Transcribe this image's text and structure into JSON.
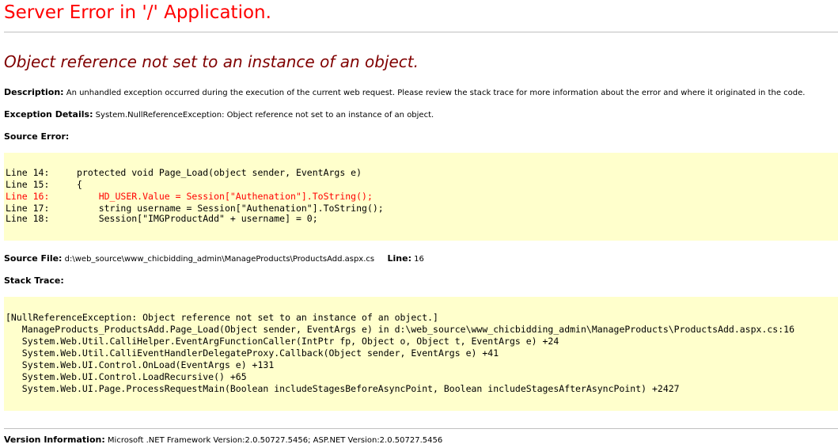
{
  "page": {
    "title": "Server Error in '/' Application.",
    "error_message": "Object reference not set to an instance of an object."
  },
  "description": {
    "label": "Description:",
    "text": "An unhandled exception occurred during the execution of the current web request. Please review the stack trace for more information about the error and where it originated in the code."
  },
  "exception_details": {
    "label": "Exception Details:",
    "text": "System.NullReferenceException: Object reference not set to an instance of an object."
  },
  "source_error": {
    "label": "Source Error:",
    "lines": [
      {
        "text": "Line 14:     protected void Page_Load(object sender, EventArgs e)",
        "is_error": false
      },
      {
        "text": "Line 15:     {",
        "is_error": false
      },
      {
        "text": "Line 16:         HD_USER.Value = Session[\"Authenation\"].ToString();",
        "is_error": true
      },
      {
        "text": "Line 17:         string username = Session[\"Authenation\"].ToString();",
        "is_error": false
      },
      {
        "text": "Line 18:         Session[\"IMGProductAdd\" + username] = 0;",
        "is_error": false
      }
    ]
  },
  "source_file": {
    "label": "Source File:",
    "path": "d:\\web_source\\www_chicbidding_admin\\ManageProducts\\ProductsAdd.aspx.cs",
    "line_label": "Line:",
    "line_number": "16"
  },
  "stack_trace": {
    "label": "Stack Trace:",
    "lines": [
      "[NullReferenceException: Object reference not set to an instance of an object.]",
      "   ManageProducts_ProductsAdd.Page_Load(Object sender, EventArgs e) in d:\\web_source\\www_chicbidding_admin\\ManageProducts\\ProductsAdd.aspx.cs:16",
      "   System.Web.Util.CalliHelper.EventArgFunctionCaller(IntPtr fp, Object o, Object t, EventArgs e) +24",
      "   System.Web.Util.CalliEventHandlerDelegateProxy.Callback(Object sender, EventArgs e) +41",
      "   System.Web.UI.Control.OnLoad(EventArgs e) +131",
      "   System.Web.UI.Control.LoadRecursive() +65",
      "   System.Web.UI.Page.ProcessRequestMain(Boolean includeStagesBeforeAsyncPoint, Boolean includeStagesAfterAsyncPoint) +2427"
    ]
  },
  "version_info": {
    "label": "Version Information:",
    "text": "Microsoft .NET Framework Version:2.0.50727.5456; ASP.NET Version:2.0.50727.5456"
  },
  "colors": {
    "title": "#ff0000",
    "error_message": "#800000",
    "code_background": "#ffffcc",
    "error_line": "#ff0000",
    "rule": "#c0c0c0"
  }
}
